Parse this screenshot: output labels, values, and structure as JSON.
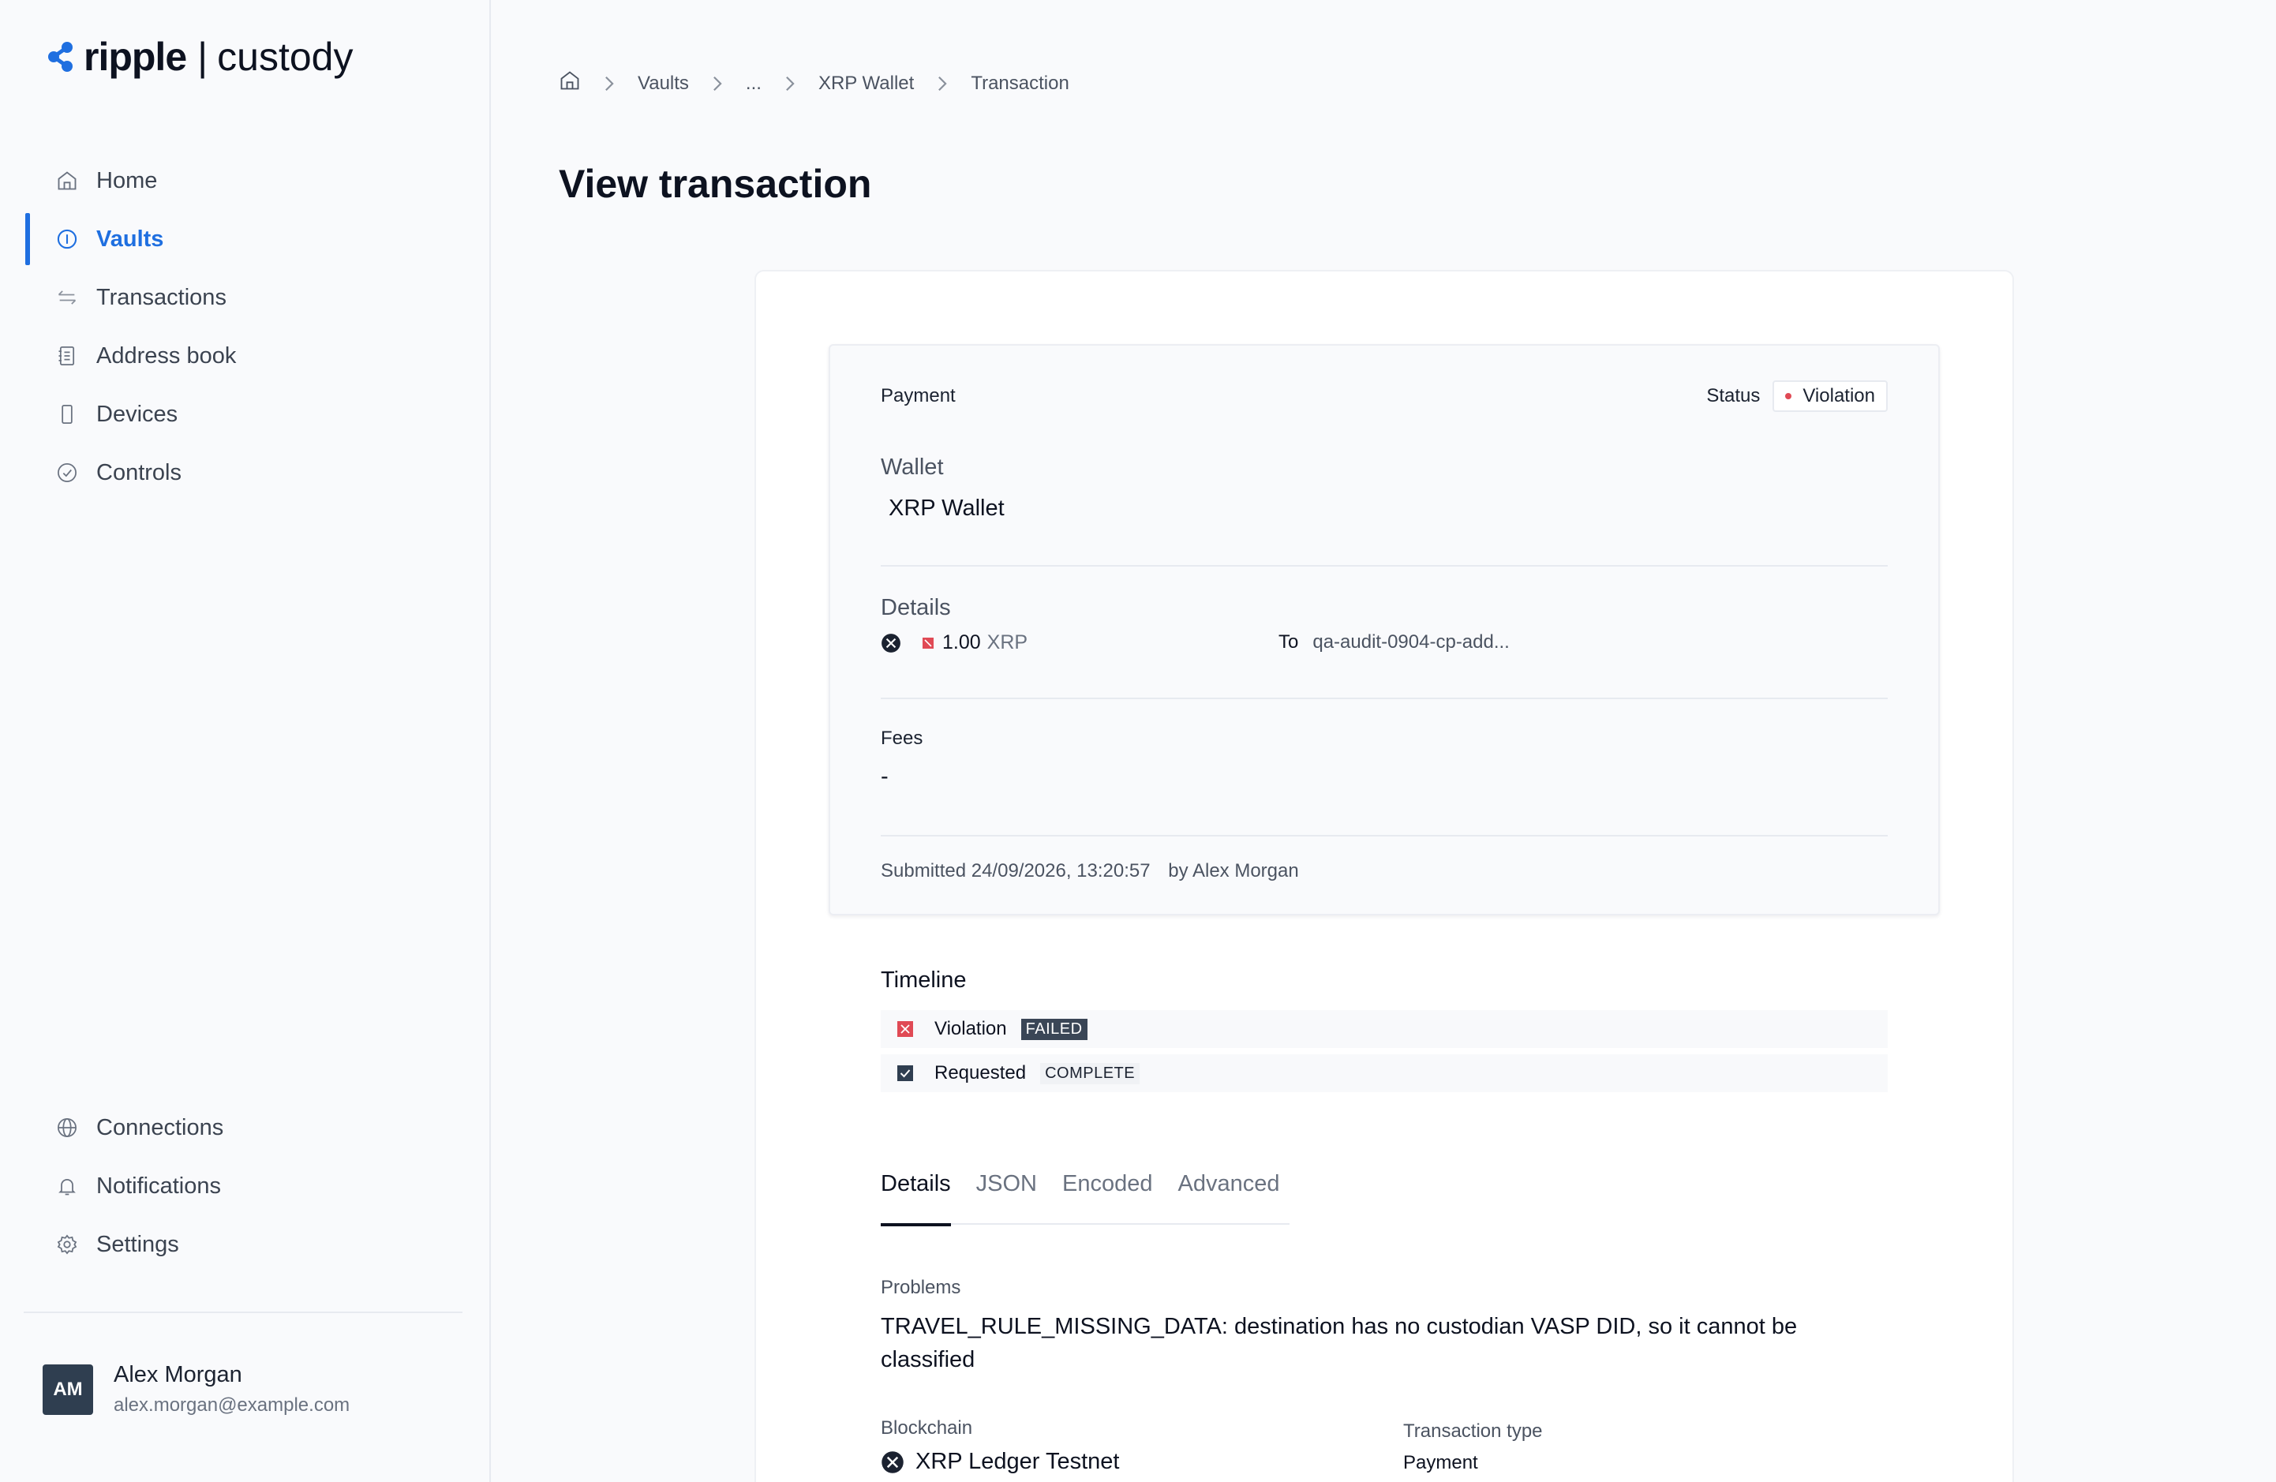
{
  "brand": {
    "name": "ripple",
    "product": "custody",
    "accent": "#1f6fe0"
  },
  "sidebar": {
    "items": [
      {
        "label": "Home",
        "icon": "home-icon"
      },
      {
        "label": "Vaults",
        "icon": "vault-icon",
        "active": true
      },
      {
        "label": "Transactions",
        "icon": "transfer-icon"
      },
      {
        "label": "Address book",
        "icon": "address-book-icon"
      },
      {
        "label": "Devices",
        "icon": "device-icon"
      },
      {
        "label": "Controls",
        "icon": "check-circle-icon"
      }
    ],
    "bottom_items": [
      {
        "label": "Connections",
        "icon": "globe-icon"
      },
      {
        "label": "Notifications",
        "icon": "bell-icon"
      },
      {
        "label": "Settings",
        "icon": "gear-icon"
      }
    ],
    "user": {
      "initials": "AM",
      "name": "Alex Morgan",
      "email": "alex.morgan@example.com"
    }
  },
  "breadcrumb": [
    "Vaults",
    "...",
    "XRP Wallet",
    "Transaction"
  ],
  "page_title": "View transaction",
  "summary": {
    "type_label": "Payment",
    "status_label": "Status",
    "status_value": "Violation",
    "status_color": "#e04a55",
    "wallet_label": "Wallet",
    "wallet_value": "XRP Wallet",
    "details_label": "Details",
    "amount": "1.00",
    "currency": "XRP",
    "to_label": "To",
    "to_value": "qa-audit-0904-cp-add...",
    "fees_label": "Fees",
    "fees_value": "-",
    "submitted": "Submitted 24/09/2026, 13:20:57",
    "submitted_by": "by Alex Morgan"
  },
  "timeline": {
    "title": "Timeline",
    "events": [
      {
        "label": "Violation",
        "tag": "FAILED"
      },
      {
        "label": "Requested",
        "tag": "COMPLETE"
      }
    ]
  },
  "tabs": [
    "Details",
    "JSON",
    "Encoded",
    "Advanced"
  ],
  "details": {
    "problems_label": "Problems",
    "problems_text": "TRAVEL_RULE_MISSING_DATA: destination has no custodian VASP DID, so it cannot be classified",
    "blockchain_label": "Blockchain",
    "blockchain_value": "XRP Ledger Testnet",
    "tx_type_label": "Transaction type",
    "tx_type_value": "Payment"
  }
}
